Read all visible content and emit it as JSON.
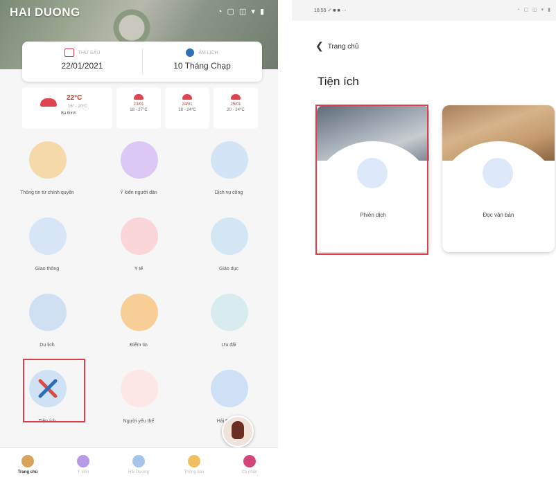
{
  "left": {
    "logo": "HAI DUONG",
    "status_icons": "◔ ▢ ◫ ▾ ▮",
    "calendar": {
      "solar_label": "THỨ SÁU",
      "solar_value": "22/01/2021",
      "lunar_label": "ÂM LỊCH",
      "lunar_value": "10 Tháng Chạp"
    },
    "weather": {
      "temp": "22°C",
      "range": "16° - 20°C",
      "location": "Ba Đình",
      "days": [
        {
          "date": "23/01",
          "range": "18 - 27°C"
        },
        {
          "date": "24/01",
          "range": "18 - 24°C"
        },
        {
          "date": "25/01",
          "range": "20 - 24°C"
        }
      ]
    },
    "grid": [
      {
        "label": "Thông tin từ chính quyền",
        "icon": "bell-icon",
        "color": "#f6d9a8"
      },
      {
        "label": "Ý kiến người dân",
        "icon": "feedback-icon",
        "color": "#dcc8f4"
      },
      {
        "label": "Dịch vụ công",
        "icon": "cards-icon",
        "color": "#d3e4f7"
      },
      {
        "label": "Giao thông",
        "icon": "traffic-light-icon",
        "color": "#d6e6f7"
      },
      {
        "label": "Y tế",
        "icon": "heart-icon",
        "color": "#fbd6d8"
      },
      {
        "label": "Giáo dục",
        "icon": "graduation-cap-icon",
        "color": "#d3e6f3"
      },
      {
        "label": "Du lịch",
        "icon": "luggage-icon",
        "color": "#cfe0f3"
      },
      {
        "label": "Điểm tin",
        "icon": "newspaper-icon",
        "color": "#f7cf96"
      },
      {
        "label": "Ưu đãi",
        "icon": "shopping-bag-icon",
        "color": "#d8ecf0"
      },
      {
        "label": "Tiện ích",
        "icon": "tools-icon",
        "color": "#cfe1f5"
      },
      {
        "label": "Người yếu thế",
        "icon": "heart-hand-icon",
        "color": "#fde6e6"
      },
      {
        "label": "Hải Dương",
        "icon": "map-icon",
        "color": "#cde0f5"
      }
    ],
    "nav": [
      {
        "label": "Trang chủ",
        "icon": "home-icon",
        "color": "#d9a45a"
      },
      {
        "label": "Ý kiến",
        "icon": "feedback-icon",
        "color": "#b79ae8"
      },
      {
        "label": "Hải Dương",
        "icon": "globe-icon",
        "color": "#a5c4ea"
      },
      {
        "label": "Thông báo",
        "icon": "bell-icon",
        "color": "#f0c060"
      },
      {
        "label": "Cá nhân",
        "icon": "user-icon",
        "color": "#d4457a"
      }
    ]
  },
  "right": {
    "time": "16:55 ✓ ■ ■ ···",
    "status_icons": "◔ ▢ ◫ ▾ ▮",
    "back_label": "Trang chủ",
    "title": "Tiện ích",
    "cards": [
      {
        "label": "Phiên dịch",
        "icon": "translate-icon"
      },
      {
        "label": "Đọc văn bản",
        "icon": "document-scan-icon"
      }
    ]
  }
}
